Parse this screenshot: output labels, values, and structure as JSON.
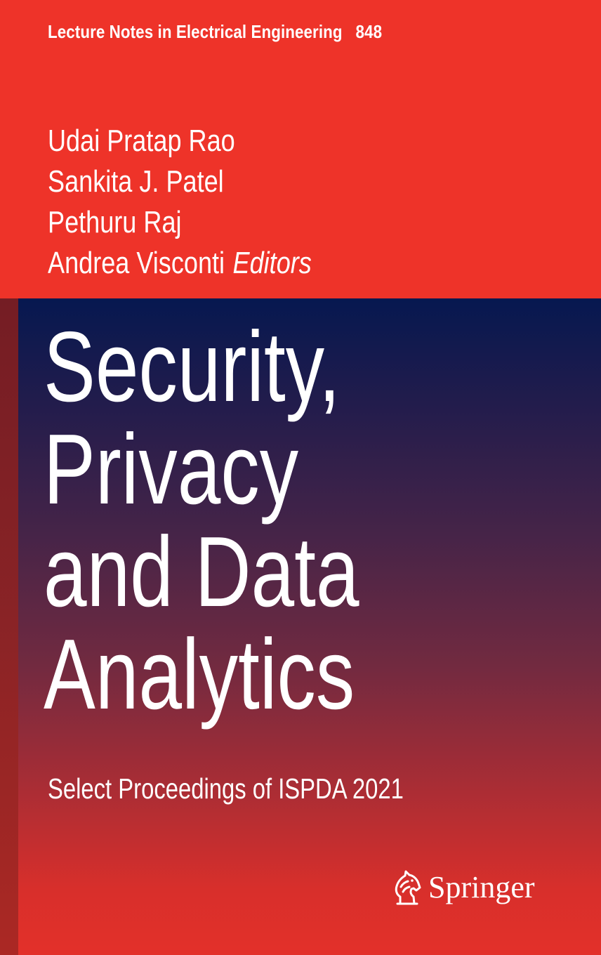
{
  "series": {
    "name": "Lecture Notes in Electrical Engineering",
    "volume": "848"
  },
  "editors": {
    "names": [
      "Udai Pratap Rao",
      "Sankita J. Patel",
      "Pethuru Raj",
      "Andrea Visconti"
    ],
    "role": "Editors"
  },
  "title": {
    "lines": [
      "Security,",
      "Privacy",
      "and Data",
      "Analytics"
    ]
  },
  "subtitle": "Select Proceedings of ISPDA 2021",
  "publisher": {
    "name": "Springer",
    "logo_icon": "springer-horse-icon"
  },
  "colors": {
    "top_band": "#ee3329",
    "panel_top": "#061850",
    "panel_bottom": "#e3302a",
    "text": "#ffffff"
  }
}
